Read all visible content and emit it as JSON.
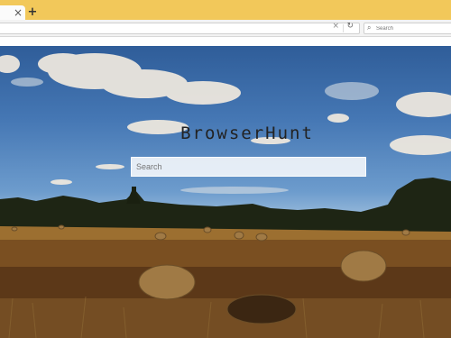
{
  "tabs": {
    "close_symbol": "×",
    "new_tab_symbol": "+"
  },
  "toolbar": {
    "url_clear_symbol": "×",
    "reload_symbol": "↻",
    "search_placeholder": "Search"
  },
  "page": {
    "logo_text": "BrowserHunt",
    "search_placeholder": "Search"
  },
  "colors": {
    "tabstrip": "#f2c85a",
    "logo_text": "#222222"
  }
}
